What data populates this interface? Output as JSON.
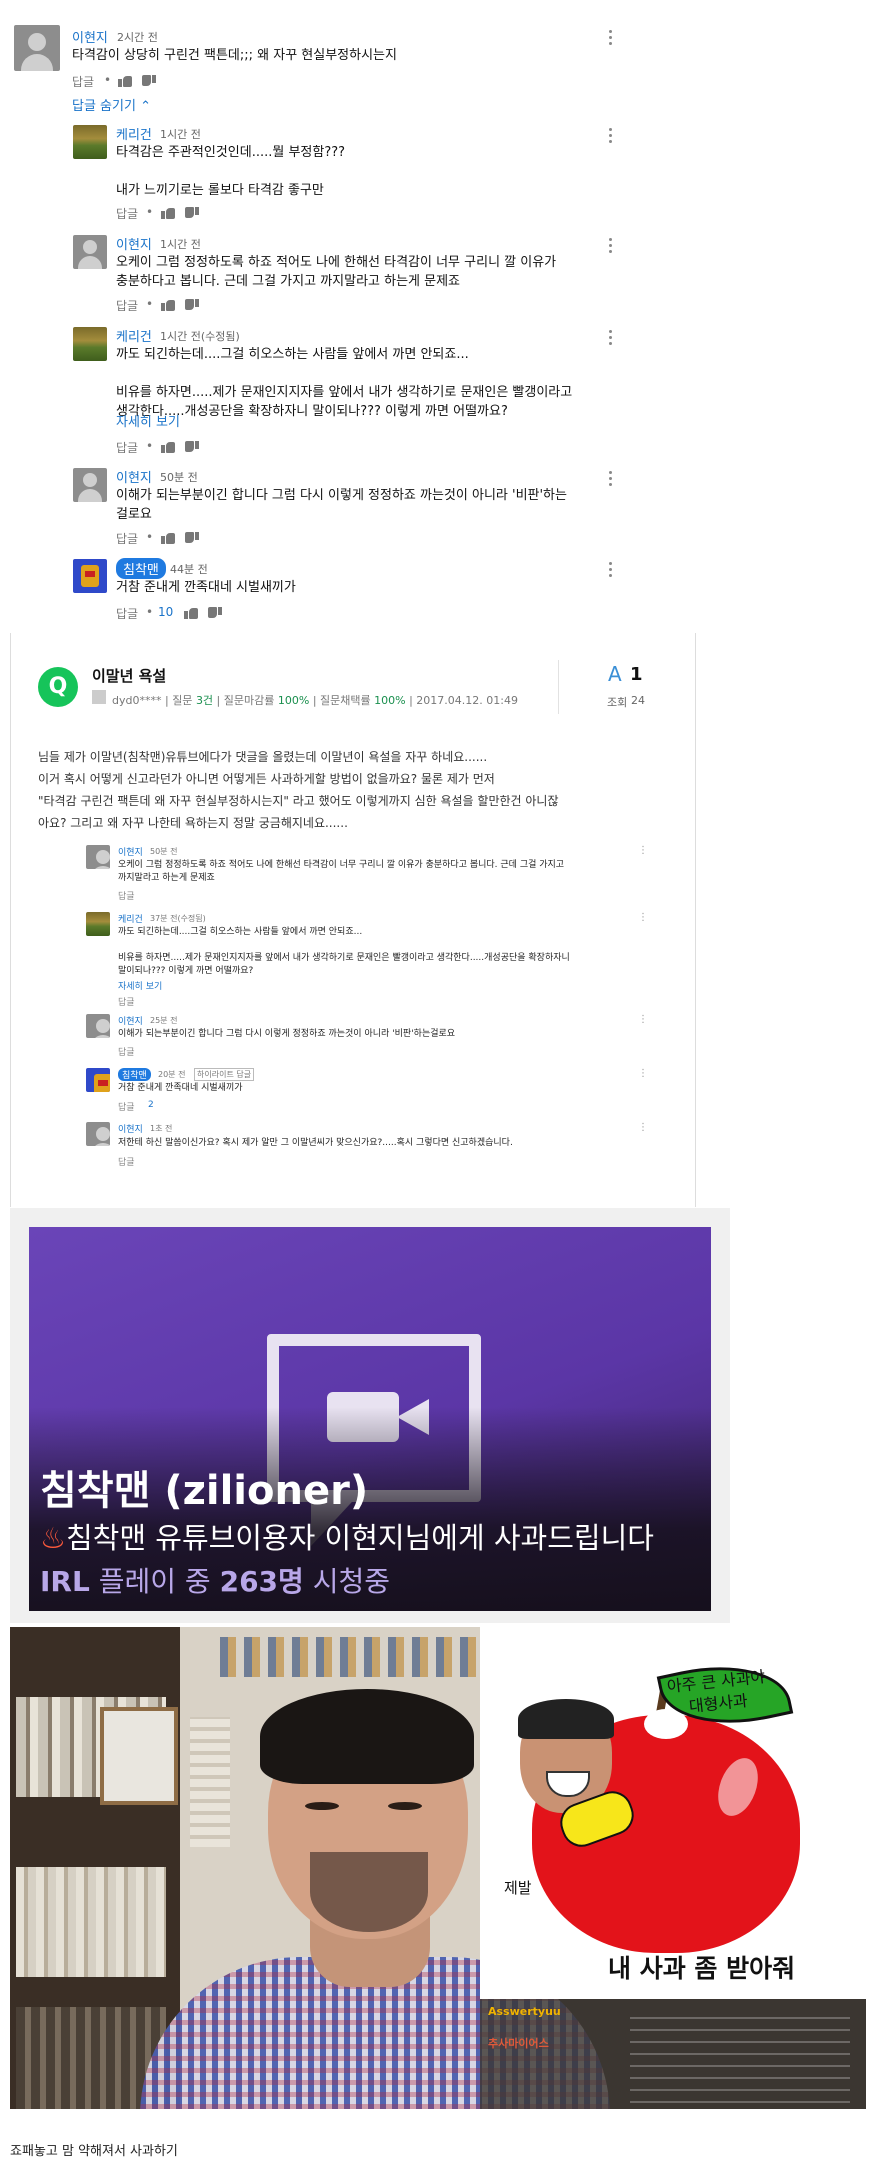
{
  "yt": {
    "comments": [
      {
        "name": "이현지",
        "time": "2시간 전",
        "text": "타격감이 상당히 구린건 팩튼데;;; 왜 자꾸 현실부정하시는지",
        "reply": "답글",
        "likes": ""
      },
      {
        "name": "케리건",
        "time": "1시간 전",
        "text": "타격감은 주관적인것인데.....뭘 부정함???\n\n내가 느끼기로는 롤보다 타격감 좋구만",
        "reply": "답글",
        "likes": ""
      },
      {
        "name": "이현지",
        "time": "1시간 전",
        "text": "오케이 그럼 정정하도록 하죠 적어도 나에 한해선 타격감이 너무 구리니 깔 이유가\n충분하다고 봅니다. 근데 그걸 가지고 까지말라고 하는게 문제죠",
        "reply": "답글",
        "likes": ""
      },
      {
        "name": "케리건",
        "time": "1시간 전(수정됨)",
        "text": "까도 되긴하는데....그걸 히오스하는 사람들 앞에서 까면 안되죠...\n\n비유를 하자면.....제가 문재인지지자를 앞에서 내가 생각하기로 문재인은 빨갱이라고\n생각한다.....개성공단을 확장하자니 말이되나??? 이렇게 까면 어떨까요?",
        "more": "자세히 보기",
        "reply": "답글",
        "likes": ""
      },
      {
        "name": "이현지",
        "time": "50분 전",
        "text": "이해가 되는부분이긴 합니다 그럼 다시 이렇게 정정하죠 까는것이 아니라 '비판'하는\n걸로요",
        "reply": "답글",
        "likes": ""
      },
      {
        "name": "침착맨",
        "time": "44분 전",
        "text": "거참 준내게 깐족대네 시벌새끼가",
        "reply": "답글",
        "likes": "10"
      }
    ],
    "hide_replies": "답글 숨기기"
  },
  "qa": {
    "q_letter": "Q",
    "title": "이말년 욕설",
    "user": "dyd0****",
    "meta_q_label": "질문",
    "meta_q_val": "3건",
    "meta_close_label": "질문마감률",
    "meta_close_val": "100%",
    "meta_choose_label": "질문채택률",
    "meta_choose_val": "100%",
    "date": "2017.04.12. 01:49",
    "answer_letter": "A",
    "answer_count": "1",
    "views_label": "조회",
    "views": "24",
    "body": "님들 제가 이말년(침착맨)유튜브에다가 댓글을 올렸는데 이말년이 욕설을 자꾸 하네요......\n이거 혹시 어떻게 신고라던가 아니면 어떻게든 사과하게할 방법이 없을까요? 물론 제가 먼저\n\"타격감 구린건 팩튼데 왜 자꾸 현실부정하시는지\" 라고 했어도 이렇게까지 심한 욕설을 할만한건 아니잖\n아요? 그리고 왜 자꾸 나한테 욕하는지 정말 궁금해지네요......",
    "mini": [
      {
        "name": "이현지",
        "time": "50분 전",
        "text": "오케이 그럼 정정하도록 하죠 적어도 나에 한해선 타격감이 너무 구리니 깔 이유가 충분하다고 봅니다. 근데 그걸 가지고\n까지말라고 하는게 문제죠",
        "reply": "답글"
      },
      {
        "name": "케리건",
        "time": "37분 전(수정됨)",
        "text": "까도 되긴하는데....그걸 히오스하는 사람들 앞에서 까면 안되죠...\n\n비유를 하자면.....제가 문재인지지자를 앞에서 내가 생각하기로 문재인은 빨갱이라고 생각한다.....개성공단을 확장하자니\n말이되나??? 이렇게 까면 어떨까요?",
        "more": "자세히 보기",
        "reply": "답글"
      },
      {
        "name": "이현지",
        "time": "25분 전",
        "text": "이해가 되는부분이긴 합니다 그럼 다시 이렇게 정정하죠 까는것이 아니라 '비판'하는걸로요",
        "reply": "답글"
      },
      {
        "name": "침착맨",
        "time": "20분 전",
        "badge": "하이라이트 답글",
        "text": "거참 준내게 깐족대네 시벌새끼가",
        "reply": "답글",
        "likes": "2"
      },
      {
        "name": "이현지",
        "time": "1초 전",
        "text": "저한테 하신 말씀이신가요? 혹시 제가 알만 그 이말년씨가 맞으신가요?.....혹시 그렇다면 신고하겠습니다.",
        "reply": "답글"
      }
    ]
  },
  "twitch": {
    "channel": "침착맨 (zilioner)",
    "fire": "♨",
    "title": "침착맨 유튜브이용자 이현지님에게 사과드립니다",
    "status_prefix": "IRL",
    "status_mid": "플레이 중",
    "viewers": "263명",
    "status_suffix": "시청중"
  },
  "video": {
    "apple_top": "아주 큰 사과야\n대형사과",
    "apple_plea": "제발",
    "apple_caption": "내 사과 좀 받아줘",
    "chat_user1": "Asswertyuu",
    "chat_user2": "추사마이어스"
  },
  "footer": "죠패놓고 맘 약해져서 사과하기"
}
